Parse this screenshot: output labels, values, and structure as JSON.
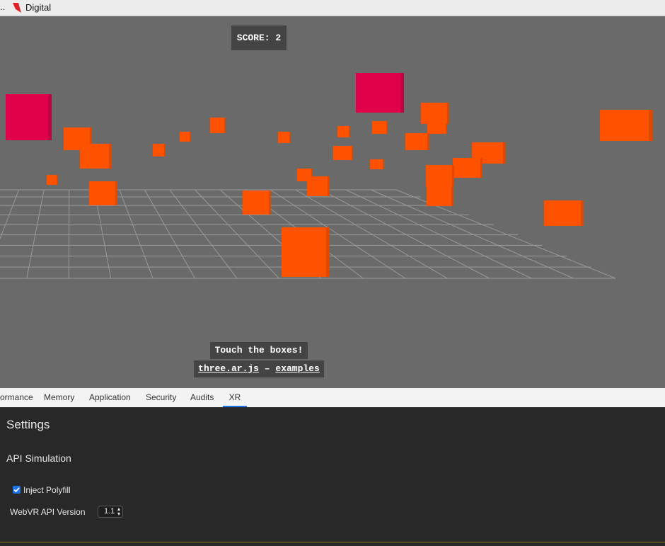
{
  "window": {
    "ellipsis": "..",
    "title": "Digital"
  },
  "game": {
    "score_label": "SCORE: 2",
    "hint": "Touch the boxes!",
    "link_lib": "three.ar.js",
    "link_sep": " – ",
    "link_examples": "examples"
  },
  "devtools": {
    "tabs": [
      {
        "label": "ormance"
      },
      {
        "label": "Memory"
      },
      {
        "label": "Application"
      },
      {
        "label": "Security"
      },
      {
        "label": "Audits"
      },
      {
        "label": "XR"
      }
    ],
    "active_tab": "XR",
    "settings_title": "Settings",
    "section_title": "API Simulation",
    "inject_polyfill": {
      "label": "Inject Polyfill",
      "checked": true
    },
    "webvr_version": {
      "label": "WebVR API Version",
      "value": "1.1"
    }
  },
  "colors": {
    "box_orange": "#ff5200",
    "box_red": "#e0004a",
    "scene_bg": "#6a6a6a",
    "accent": "#1a73e8"
  }
}
